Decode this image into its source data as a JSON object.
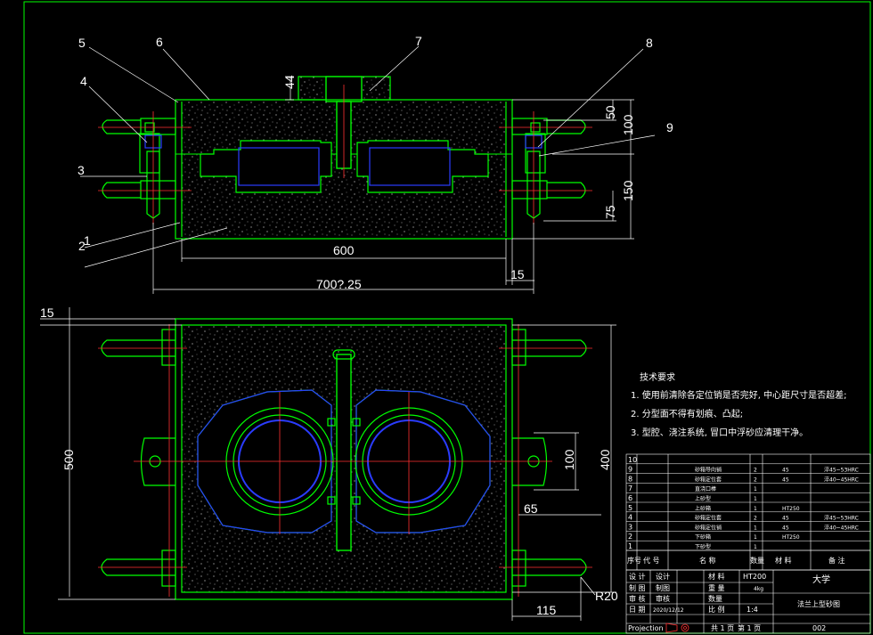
{
  "colors": {
    "background": "#000000",
    "outline": "#00ff00",
    "centerline": "#ff3030",
    "hidden": "#2a3cff",
    "dimension": "#ffffff",
    "frame": "#00ff00"
  },
  "part_labels": [
    "1",
    "2",
    "3",
    "4",
    "5",
    "6",
    "7",
    "8",
    "9"
  ],
  "dimensions": {
    "top_view": [
      "44",
      "50",
      "100",
      "150",
      "75",
      "600",
      "15",
      "700?.25"
    ],
    "bottom_view": [
      "15",
      "500",
      "100",
      "400",
      "65",
      "115",
      "R20"
    ]
  },
  "technical_requirements": {
    "title": "技术要求",
    "items": [
      "1. 使用前清除各定位销是否完好, 中心距尺寸是否超差;",
      "2. 分型面不得有划痕、凸起;",
      "3. 型腔、浇注系统, 冒口中浮砂应清理干净。"
    ]
  },
  "parts_list": {
    "rows": [
      {
        "no": "10",
        "name": "",
        "qty": "",
        "material": "",
        "note": ""
      },
      {
        "no": "9",
        "name": "砂箱导向销",
        "qty": "2",
        "material": "45",
        "note": "淬45~53HRC"
      },
      {
        "no": "8",
        "name": "砂箱定位套",
        "qty": "2",
        "material": "45",
        "note": "淬40~45HRC"
      },
      {
        "no": "7",
        "name": "直浇口棒",
        "qty": "1",
        "material": "",
        "note": ""
      },
      {
        "no": "6",
        "name": "上砂型",
        "qty": "1",
        "material": "",
        "note": ""
      },
      {
        "no": "5",
        "name": "上砂箱",
        "qty": "1",
        "material": "HT250",
        "note": ""
      },
      {
        "no": "4",
        "name": "砂箱定位套",
        "qty": "2",
        "material": "45",
        "note": "淬45~53HRC"
      },
      {
        "no": "3",
        "name": "砂箱定位销",
        "qty": "1",
        "material": "45",
        "note": "淬40~45HRC"
      },
      {
        "no": "2",
        "name": "下砂箱",
        "qty": "1",
        "material": "HT250",
        "note": ""
      },
      {
        "no": "1",
        "name": "下砂型",
        "qty": "1",
        "material": "",
        "note": ""
      }
    ],
    "header": {
      "no": "序号",
      "code": "代 号",
      "name": "名 称",
      "qty": "数量",
      "material": "材 料",
      "note": "备 注"
    }
  },
  "title_block": {
    "design": "设 计",
    "design2": "设计",
    "material_label": "材 料",
    "material": "HT200",
    "drawing": "制 图",
    "drawing2": "制图",
    "weight_label": "重 量",
    "weight": "4kg",
    "check": "审 核",
    "check2": "审核",
    "count_label": "数量",
    "date_label": "日 期",
    "date": "2020/12/12",
    "scale_label": "比 例",
    "scale": "1:4",
    "projection": "Projection",
    "sheets": "共 1 页",
    "sheet_no": "第 1 页",
    "school": "大学",
    "drawing_title": "法兰上型砂图",
    "drawing_number": "002"
  }
}
